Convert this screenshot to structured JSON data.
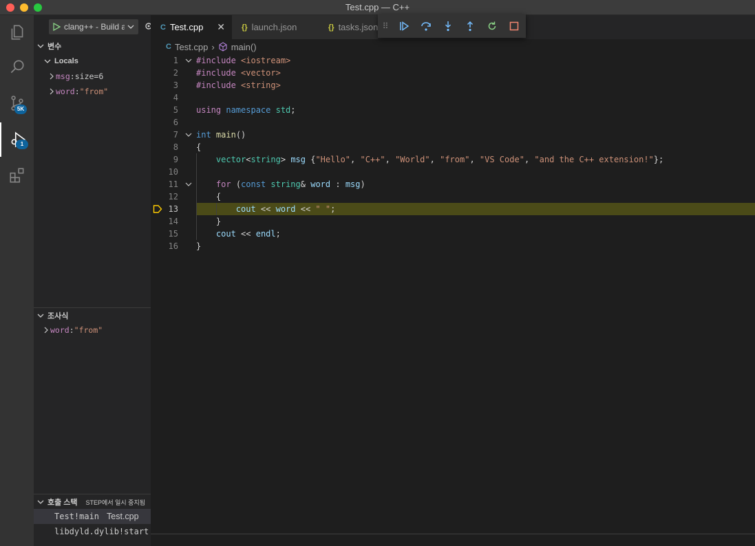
{
  "window": {
    "title": "Test.cpp — C++"
  },
  "activity_bar": {
    "items": [
      {
        "name": "explorer"
      },
      {
        "name": "search"
      },
      {
        "name": "source-control",
        "badge": "5K"
      },
      {
        "name": "run-debug",
        "badge": "1"
      },
      {
        "name": "extensions"
      }
    ]
  },
  "sidebar": {
    "launch_config": "clang++ - Build and debug active file",
    "variables": {
      "title": "변수",
      "locals_title": "Locals",
      "items": [
        {
          "name": "msg",
          "sep": ": ",
          "value": "size=6"
        },
        {
          "name": "word",
          "sep": ": ",
          "value": "\"from\""
        }
      ]
    },
    "watch": {
      "title": "조사식",
      "items": [
        {
          "name": "word",
          "sep": ": ",
          "value": "\"from\""
        }
      ]
    },
    "call_stack": {
      "title": "호출 스택",
      "status": "STEP에서 일시 중지됨",
      "frames": [
        {
          "name": "Test!main",
          "file": "Test.cpp"
        },
        {
          "name": "libdyld.dylib!start",
          "file": ""
        }
      ]
    }
  },
  "tabs": [
    {
      "label": "Test.cpp",
      "icon": "C",
      "active": true
    },
    {
      "label": "launch.json",
      "icon": "{}",
      "active": false
    },
    {
      "label": "tasks.json",
      "icon": "{}",
      "active": false
    }
  ],
  "debug_toolbar": {
    "buttons": [
      "continue",
      "step-over",
      "step-into",
      "step-out",
      "restart",
      "stop"
    ]
  },
  "breadcrumb": {
    "file": "Test.cpp",
    "symbol": "main()"
  },
  "editor": {
    "current_line": 13,
    "lines": [
      {
        "n": "1",
        "fold": "v",
        "segments": [
          [
            "pp",
            "#include "
          ],
          [
            "inc",
            "<iostream>"
          ]
        ]
      },
      {
        "n": "2",
        "fold": "",
        "segments": [
          [
            "pp",
            "#include "
          ],
          [
            "inc",
            "<vector>"
          ]
        ]
      },
      {
        "n": "3",
        "fold": "",
        "segments": [
          [
            "pp",
            "#include "
          ],
          [
            "inc",
            "<string>"
          ]
        ]
      },
      {
        "n": "4",
        "fold": "",
        "segments": []
      },
      {
        "n": "5",
        "fold": "",
        "segments": [
          [
            "ctl",
            "using "
          ],
          [
            "kw",
            "namespace "
          ],
          [
            "ty",
            "std"
          ],
          [
            "",
            ";"
          ]
        ]
      },
      {
        "n": "6",
        "fold": "",
        "segments": []
      },
      {
        "n": "7",
        "fold": "v",
        "segments": [
          [
            "kw",
            "int "
          ],
          [
            "fn",
            "main"
          ],
          [
            "",
            "()"
          ]
        ]
      },
      {
        "n": "8",
        "fold": "",
        "segments": [
          [
            "",
            "{"
          ]
        ]
      },
      {
        "n": "9",
        "fold": "",
        "segments": [
          [
            "",
            "    "
          ],
          [
            "ty",
            "vector"
          ],
          [
            "",
            "<"
          ],
          [
            "ty",
            "string"
          ],
          [
            "",
            "> "
          ],
          [
            "vr",
            "msg"
          ],
          [
            "",
            " {"
          ],
          [
            "str",
            "\"Hello\""
          ],
          [
            "",
            ", "
          ],
          [
            "str",
            "\"C++\""
          ],
          [
            "",
            ", "
          ],
          [
            "str",
            "\"World\""
          ],
          [
            "",
            ", "
          ],
          [
            "str",
            "\"from\""
          ],
          [
            "",
            ", "
          ],
          [
            "str",
            "\"VS Code\""
          ],
          [
            "",
            ", "
          ],
          [
            "str",
            "\"and the C++ extension!\""
          ],
          [
            "",
            "};"
          ]
        ]
      },
      {
        "n": "10",
        "fold": "",
        "segments": []
      },
      {
        "n": "11",
        "fold": "v",
        "segments": [
          [
            "",
            "    "
          ],
          [
            "ctl",
            "for"
          ],
          [
            "",
            " ("
          ],
          [
            "kw",
            "const "
          ],
          [
            "ty",
            "string"
          ],
          [
            "",
            "& "
          ],
          [
            "vr",
            "word"
          ],
          [
            "",
            " : "
          ],
          [
            "vr",
            "msg"
          ],
          [
            "",
            ")"
          ]
        ]
      },
      {
        "n": "12",
        "fold": "",
        "segments": [
          [
            "",
            "    {"
          ]
        ]
      },
      {
        "n": "13",
        "fold": "",
        "segments": [
          [
            "",
            "        "
          ],
          [
            "vr",
            "cout"
          ],
          [
            "",
            " << "
          ],
          [
            "vr",
            "word"
          ],
          [
            "",
            " << "
          ],
          [
            "str",
            "\" \""
          ],
          [
            "",
            ";"
          ]
        ]
      },
      {
        "n": "14",
        "fold": "",
        "segments": [
          [
            "",
            "    }"
          ]
        ]
      },
      {
        "n": "15",
        "fold": "",
        "segments": [
          [
            "",
            "    "
          ],
          [
            "vr",
            "cout"
          ],
          [
            "",
            " << "
          ],
          [
            "vr",
            "endl"
          ],
          [
            "",
            ";"
          ]
        ]
      },
      {
        "n": "16",
        "fold": "",
        "segments": [
          [
            "",
            "}"
          ]
        ]
      }
    ]
  },
  "colors": {
    "accent": "#0e639c",
    "current_line_highlight": "#4b4b18",
    "debug_arrow": "#ffcc00"
  }
}
